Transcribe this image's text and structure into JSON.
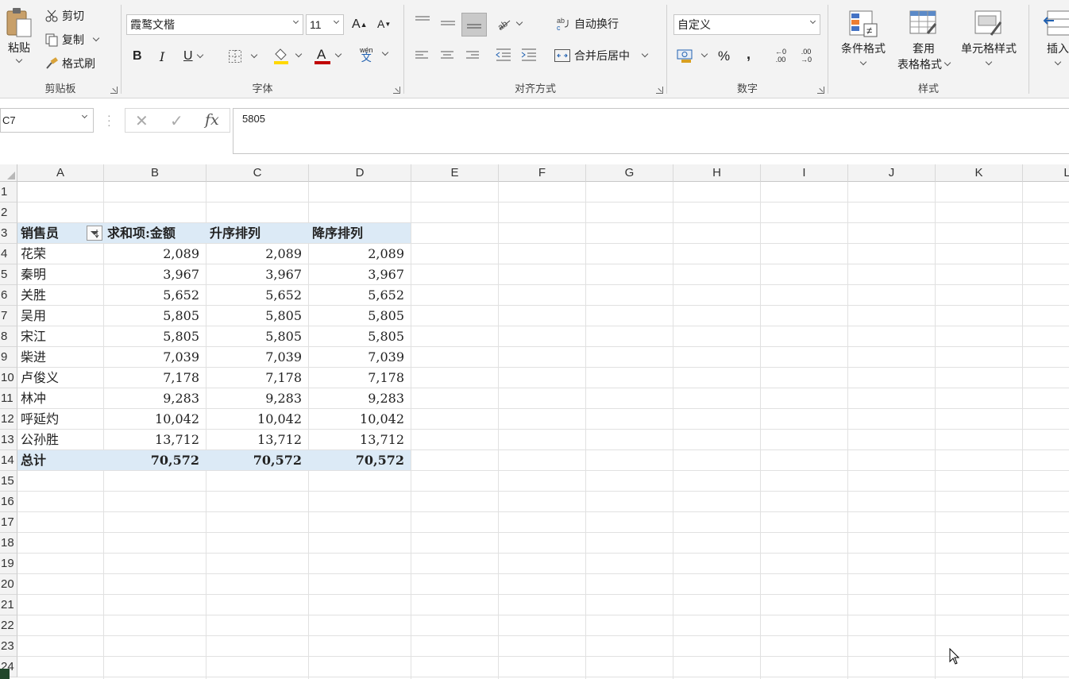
{
  "ribbon": {
    "clipboard": {
      "paste": "粘贴",
      "cut": "剪切",
      "copy": "复制",
      "format_painter": "格式刷",
      "group_label": "剪贴板"
    },
    "font": {
      "font_name": "霞鹜文楷",
      "font_size": "11",
      "group_label": "字体",
      "bold": "B",
      "italic": "I",
      "underline": "U",
      "font_color": "#c00000",
      "fill_color": "#ffd800",
      "phonetic_top": "wén",
      "phonetic_bottom": "文"
    },
    "alignment": {
      "wrap_text": "自动换行",
      "merge_center": "合并后居中",
      "group_label": "对齐方式"
    },
    "number": {
      "format": "自定义",
      "percent": "%",
      "comma": ",",
      "inc_decimal_top": "←0",
      "inc_decimal_bottom": ".00",
      "dec_decimal_top": ".00",
      "dec_decimal_bottom": "→0",
      "group_label": "数字"
    },
    "styles": {
      "conditional": "条件格式",
      "table_line1": "套用",
      "table_line2": "表格格式",
      "cell_styles": "单元格样式",
      "group_label": "样式"
    },
    "cells": {
      "insert": "插入"
    }
  },
  "formula_bar": {
    "name_box": "C7",
    "formula": "5805"
  },
  "grid": {
    "columns": [
      "A",
      "B",
      "C",
      "D",
      "E",
      "F",
      "G",
      "H",
      "I",
      "J",
      "K",
      "L"
    ],
    "rows": [
      "1",
      "2",
      "3",
      "4",
      "5",
      "6",
      "7",
      "8",
      "9",
      "10",
      "11",
      "12",
      "13",
      "14",
      "15",
      "16",
      "17",
      "18",
      "19",
      "20",
      "21",
      "22",
      "23",
      "24"
    ],
    "header_row": [
      "销售员",
      "求和项:金额",
      "升序排列",
      "降序排列"
    ],
    "data_rows": [
      [
        "花荣",
        "2,089",
        "2,089",
        "2,089"
      ],
      [
        "秦明",
        "3,967",
        "3,967",
        "3,967"
      ],
      [
        "关胜",
        "5,652",
        "5,652",
        "5,652"
      ],
      [
        "吴用",
        "5,805",
        "5,805",
        "5,805"
      ],
      [
        "宋江",
        "5,805",
        "5,805",
        "5,805"
      ],
      [
        "柴进",
        "7,039",
        "7,039",
        "7,039"
      ],
      [
        "卢俊义",
        "7,178",
        "7,178",
        "7,178"
      ],
      [
        "林冲",
        "9,283",
        "9,283",
        "9,283"
      ],
      [
        "呼延灼",
        "10,042",
        "10,042",
        "10,042"
      ],
      [
        "公孙胜",
        "13,712",
        "13,712",
        "13,712"
      ]
    ],
    "total_row": [
      "总计",
      "70,572",
      "70,572",
      "70,572"
    ],
    "pivot_band_color": "#dceaf6"
  }
}
